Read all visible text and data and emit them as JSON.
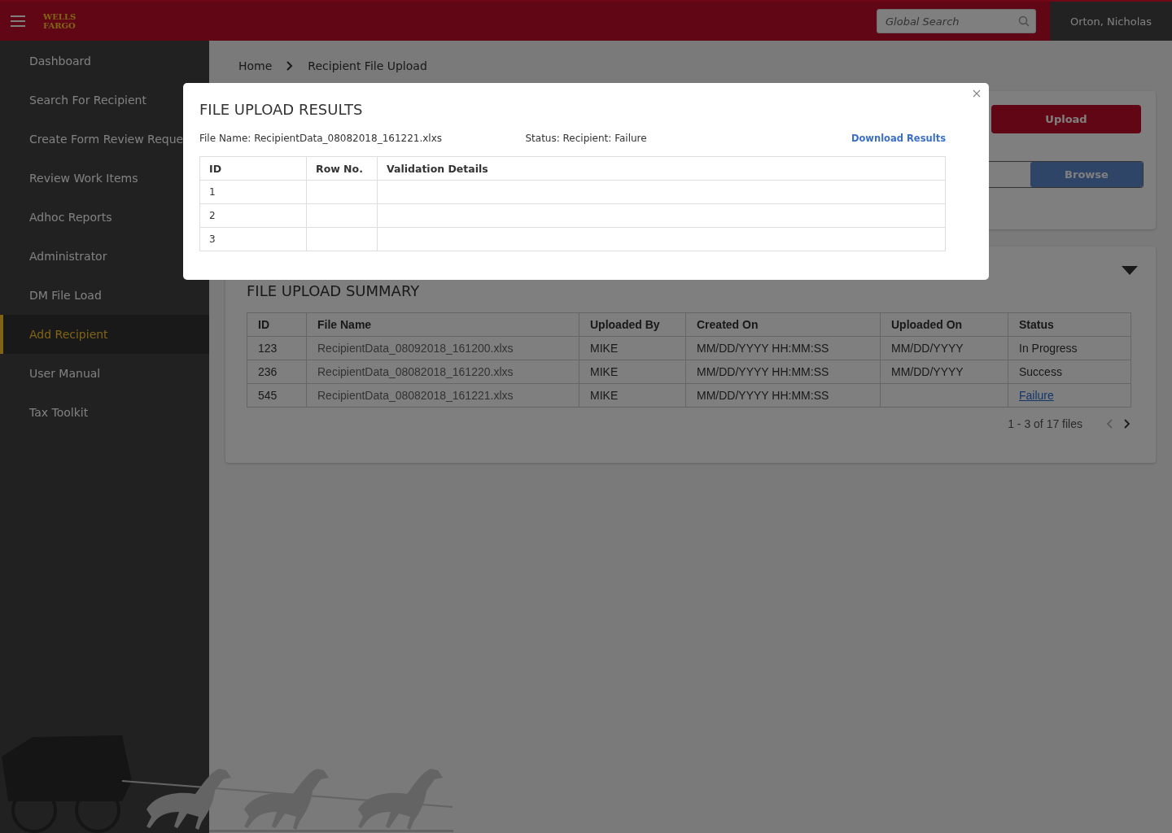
{
  "header": {
    "logo": [
      "WELLS",
      "FARGO"
    ],
    "search": {
      "placeholder": "Global Search"
    },
    "user": "Orton, Nicholas"
  },
  "sidebar": {
    "items": [
      {
        "label": "Dashboard",
        "selected": false
      },
      {
        "label": "Search For Recipient",
        "selected": false
      },
      {
        "label": "Create Form Review Reque",
        "selected": false
      },
      {
        "label": "Review Work Items",
        "selected": false
      },
      {
        "label": "Adhoc Reports",
        "selected": false
      },
      {
        "label": "Administrator",
        "selected": false
      },
      {
        "label": "DM File Load",
        "selected": false
      },
      {
        "label": "Add Recipient",
        "selected": true
      },
      {
        "label": "User Manual",
        "selected": false
      },
      {
        "label": "Tax Toolkit",
        "selected": false
      }
    ]
  },
  "breadcrumb": [
    "Home",
    "Recipient File Upload"
  ],
  "upload_card": {
    "upload_button": "Upload",
    "browse_button": "Browse"
  },
  "summary": {
    "title": "FILE UPLOAD SUMMARY",
    "columns": [
      "ID",
      "File Name",
      "Uploaded By",
      "Created On",
      "Uploaded On",
      "Status"
    ],
    "rows": [
      {
        "cells": [
          "123",
          "RecipientData_08092018_161200.xlxs",
          "MIKE",
          "MM/DD/YYYY HH:MM:SS",
          "MM/DD/YYYY",
          "In Progress"
        ],
        "kind": "text"
      },
      {
        "cells": [
          "236",
          "RecipientData_08082018_161220.xlxs",
          "MIKE",
          "MM/DD/YYYY HH:MM:SS",
          "MM/DD/YYYY",
          "Success"
        ],
        "kind": "text"
      },
      {
        "cells": [
          "545",
          "RecipientData_08082018_161221.xlxs",
          "MIKE",
          "MM/DD/YYYY HH:MM:SS",
          "",
          "Failure"
        ],
        "kind": "link"
      }
    ],
    "pagination": "1 - 3 of 17 files"
  },
  "modal": {
    "title": "FILE UPLOAD RESULTS",
    "file_name": "File Name: RecipientData_08082018_161221.xlxs",
    "status": "Status: Recipient: Failure",
    "download_link": "Download Results",
    "columns": [
      "ID",
      "Row No.",
      "Validation Details"
    ],
    "rows": [
      {
        "id": "1"
      },
      {
        "id": "2"
      },
      {
        "id": "3"
      }
    ]
  }
}
